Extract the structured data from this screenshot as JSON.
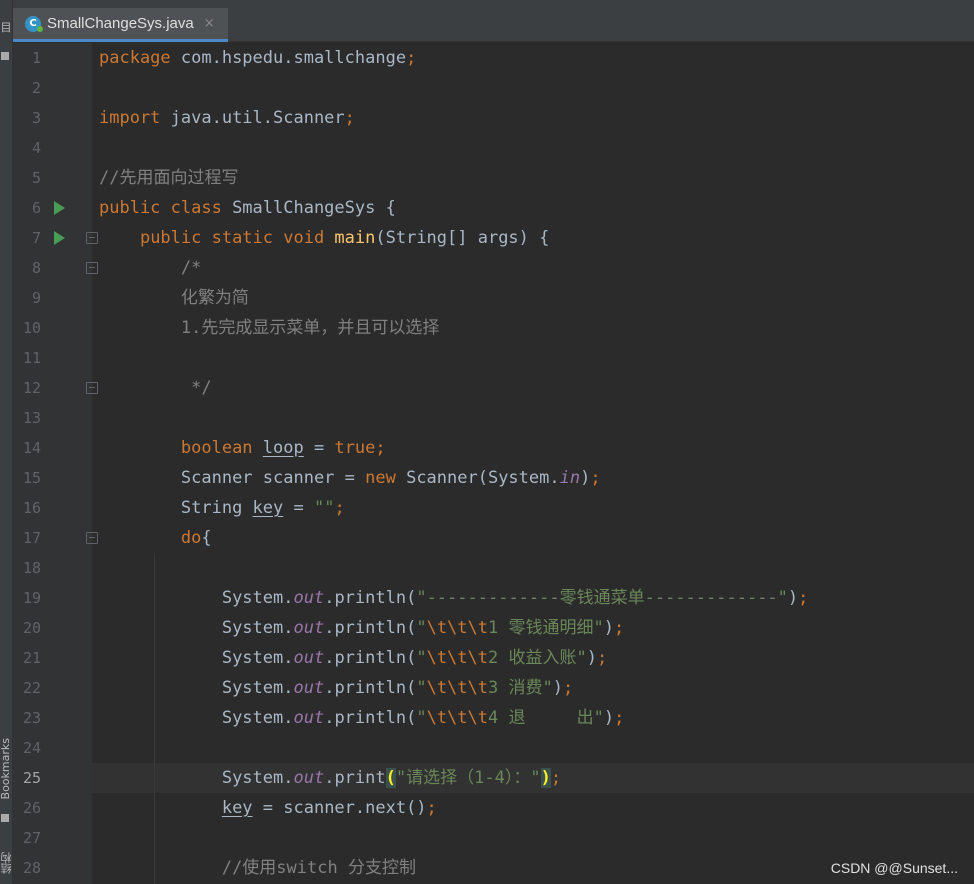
{
  "tab": {
    "title": "SmallChangeSys.java",
    "close": "×"
  },
  "side_strip": {
    "top_label": "目",
    "bookmarks": "Bookmarks",
    "structure": "结构"
  },
  "watermark": "CSDN @@Sunset...",
  "editor": {
    "current_line": 25,
    "lines": [
      {
        "n": "1",
        "segs": [
          {
            "t": "package ",
            "c": "kw"
          },
          {
            "t": "com.hspedu.smallchange"
          },
          {
            "t": ";",
            "c": "kw"
          }
        ]
      },
      {
        "n": "2",
        "segs": []
      },
      {
        "n": "3",
        "segs": [
          {
            "t": "import ",
            "c": "kw"
          },
          {
            "t": "java.util.Scanner"
          },
          {
            "t": ";",
            "c": "kw"
          }
        ]
      },
      {
        "n": "4",
        "segs": []
      },
      {
        "n": "5",
        "segs": [
          {
            "t": "//先用面向过程写",
            "c": "cm"
          }
        ]
      },
      {
        "n": "6",
        "segs": [
          {
            "t": "public class ",
            "c": "kw"
          },
          {
            "t": "SmallChangeSys {"
          }
        ]
      },
      {
        "n": "7",
        "segs": [
          {
            "t": "    "
          },
          {
            "t": "public static void ",
            "c": "kw"
          },
          {
            "t": "main",
            "c": "fn"
          },
          {
            "t": "(String[] args) {"
          }
        ]
      },
      {
        "n": "8",
        "segs": [
          {
            "t": "        "
          },
          {
            "t": "/*",
            "c": "cm"
          }
        ]
      },
      {
        "n": "9",
        "segs": [
          {
            "t": "        "
          },
          {
            "t": "化繁为简",
            "c": "cm"
          }
        ]
      },
      {
        "n": "10",
        "segs": [
          {
            "t": "        "
          },
          {
            "t": "1.先完成显示菜单，并且可以选择",
            "c": "cm"
          }
        ]
      },
      {
        "n": "11",
        "segs": []
      },
      {
        "n": "12",
        "segs": [
          {
            "t": "         "
          },
          {
            "t": "*/",
            "c": "cm"
          }
        ]
      },
      {
        "n": "13",
        "segs": []
      },
      {
        "n": "14",
        "segs": [
          {
            "t": "        "
          },
          {
            "t": "boolean ",
            "c": "kw"
          },
          {
            "t": "loop",
            "c": "ul"
          },
          {
            "t": " = "
          },
          {
            "t": "true",
            "c": "kw"
          },
          {
            "t": ";",
            "c": "kw"
          }
        ]
      },
      {
        "n": "15",
        "segs": [
          {
            "t": "        "
          },
          {
            "t": "Scanner scanner = "
          },
          {
            "t": "new ",
            "c": "kw"
          },
          {
            "t": "Scanner(System."
          },
          {
            "t": "in",
            "c": "fld"
          },
          {
            "t": ")"
          },
          {
            "t": ";",
            "c": "kw"
          }
        ]
      },
      {
        "n": "16",
        "segs": [
          {
            "t": "        "
          },
          {
            "t": "String "
          },
          {
            "t": "key",
            "c": "ul"
          },
          {
            "t": " = "
          },
          {
            "t": "\"\"",
            "c": "str"
          },
          {
            "t": ";",
            "c": "kw"
          }
        ]
      },
      {
        "n": "17",
        "segs": [
          {
            "t": "        "
          },
          {
            "t": "do",
            "c": "kw"
          },
          {
            "t": "{"
          }
        ]
      },
      {
        "n": "18",
        "segs": []
      },
      {
        "n": "19",
        "segs": [
          {
            "t": "            "
          },
          {
            "t": "System."
          },
          {
            "t": "out",
            "c": "fld"
          },
          {
            "t": ".println("
          },
          {
            "t": "\"-------------零钱通菜单-------------\"",
            "c": "str"
          },
          {
            "t": ")"
          },
          {
            "t": ";",
            "c": "kw"
          }
        ]
      },
      {
        "n": "20",
        "segs": [
          {
            "t": "            "
          },
          {
            "t": "System."
          },
          {
            "t": "out",
            "c": "fld"
          },
          {
            "t": ".println("
          },
          {
            "t": "\"",
            "c": "str"
          },
          {
            "t": "\\t\\t\\t",
            "c": "esc"
          },
          {
            "t": "1 零钱通明细\"",
            "c": "str"
          },
          {
            "t": ")"
          },
          {
            "t": ";",
            "c": "kw"
          }
        ]
      },
      {
        "n": "21",
        "segs": [
          {
            "t": "            "
          },
          {
            "t": "System."
          },
          {
            "t": "out",
            "c": "fld"
          },
          {
            "t": ".println("
          },
          {
            "t": "\"",
            "c": "str"
          },
          {
            "t": "\\t\\t\\t",
            "c": "esc"
          },
          {
            "t": "2 收益入账\"",
            "c": "str"
          },
          {
            "t": ")"
          },
          {
            "t": ";",
            "c": "kw"
          }
        ]
      },
      {
        "n": "22",
        "segs": [
          {
            "t": "            "
          },
          {
            "t": "System."
          },
          {
            "t": "out",
            "c": "fld"
          },
          {
            "t": ".println("
          },
          {
            "t": "\"",
            "c": "str"
          },
          {
            "t": "\\t\\t\\t",
            "c": "esc"
          },
          {
            "t": "3 消费\"",
            "c": "str"
          },
          {
            "t": ")"
          },
          {
            "t": ";",
            "c": "kw"
          }
        ]
      },
      {
        "n": "23",
        "segs": [
          {
            "t": "            "
          },
          {
            "t": "System."
          },
          {
            "t": "out",
            "c": "fld"
          },
          {
            "t": ".println("
          },
          {
            "t": "\"",
            "c": "str"
          },
          {
            "t": "\\t\\t\\t",
            "c": "esc"
          },
          {
            "t": "4 退     出\"",
            "c": "str"
          },
          {
            "t": ")"
          },
          {
            "t": ";",
            "c": "kw"
          }
        ]
      },
      {
        "n": "24",
        "segs": []
      },
      {
        "n": "25",
        "segs": [
          {
            "t": "            "
          },
          {
            "t": "System."
          },
          {
            "t": "out",
            "c": "fld"
          },
          {
            "t": ".print"
          },
          {
            "t": "(",
            "c": "brace-hl",
            "cursor": true
          },
          {
            "t": "\"请选择（1-4）：\"",
            "c": "str"
          },
          {
            "t": ")",
            "c": "brace-hl"
          },
          {
            "t": ";",
            "c": "kw"
          }
        ]
      },
      {
        "n": "26",
        "segs": [
          {
            "t": "            "
          },
          {
            "t": "key",
            "c": "ul"
          },
          {
            "t": " = scanner.next()"
          },
          {
            "t": ";",
            "c": "kw"
          }
        ]
      },
      {
        "n": "27",
        "segs": []
      },
      {
        "n": "28",
        "segs": [
          {
            "t": "            "
          },
          {
            "t": "//使用switch 分支控制",
            "c": "cm"
          }
        ]
      }
    ],
    "run_lines": [
      6,
      7
    ],
    "fold_lines": [
      7,
      8,
      12,
      17
    ]
  }
}
